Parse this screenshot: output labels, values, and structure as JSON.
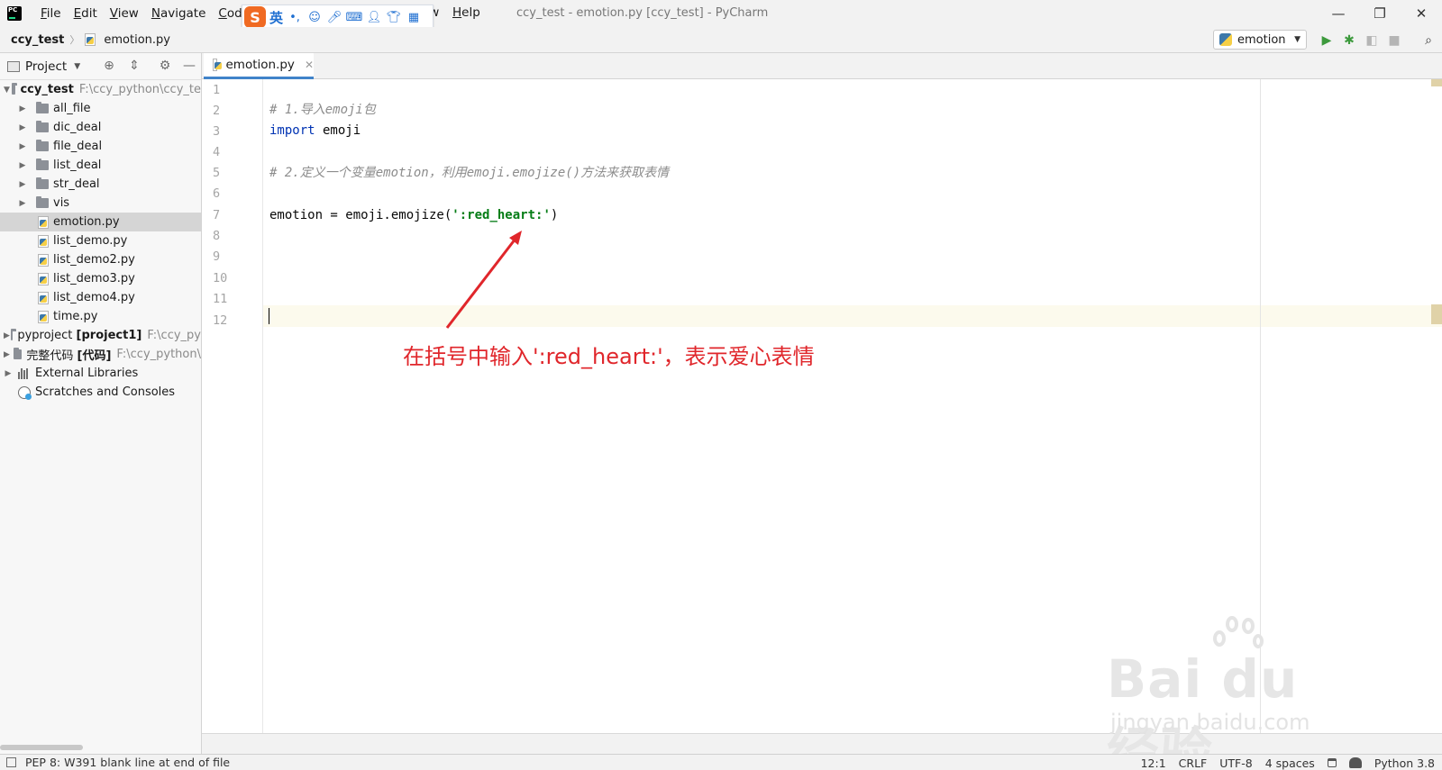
{
  "window": {
    "title": "ccy_test - emotion.py [ccy_test] - PyCharm",
    "controls": [
      "—",
      "❐",
      "✕"
    ]
  },
  "menu": {
    "items": [
      {
        "label": "File",
        "mnemonic": "F",
        "rest": "ile"
      },
      {
        "label": "Edit",
        "mnemonic": "E",
        "rest": "dit"
      },
      {
        "label": "View",
        "mnemonic": "V",
        "rest": "iew"
      },
      {
        "label": "Navigate",
        "mnemonic": "N",
        "rest": "avigate"
      },
      {
        "label": "Code",
        "mnemonic": "C",
        "rest": "ode"
      },
      {
        "label": "R",
        "mnemonic": "R",
        "rest": ""
      },
      {
        "label": "ow",
        "mnemonic": "",
        "rest": "ow"
      },
      {
        "label": "Help",
        "mnemonic": "H",
        "rest": "elp"
      }
    ]
  },
  "ime": {
    "logo": "S",
    "mode": "英",
    "punct": "•,"
  },
  "navbar": {
    "project": "ccy_test",
    "file": "emotion.py",
    "run_config": "emotion"
  },
  "project_panel": {
    "title": "Project",
    "tree": [
      {
        "label": "ccy_test",
        "hint": "F:\\ccy_python\\ccy_te",
        "type": "folder",
        "expanded": true,
        "depth": 0,
        "bold": true
      },
      {
        "label": "all_file",
        "type": "folder",
        "expanded": false,
        "depth": 1
      },
      {
        "label": "dic_deal",
        "type": "folder",
        "expanded": false,
        "depth": 1
      },
      {
        "label": "file_deal",
        "type": "folder",
        "expanded": false,
        "depth": 1
      },
      {
        "label": "list_deal",
        "type": "folder",
        "expanded": false,
        "depth": 1
      },
      {
        "label": "str_deal",
        "type": "folder",
        "expanded": false,
        "depth": 1
      },
      {
        "label": "vis",
        "type": "folder",
        "expanded": false,
        "depth": 1
      },
      {
        "label": "emotion.py",
        "type": "py",
        "depth": 1,
        "selected": true
      },
      {
        "label": "list_demo.py",
        "type": "py",
        "depth": 1
      },
      {
        "label": "list_demo2.py",
        "type": "py",
        "depth": 1
      },
      {
        "label": "list_demo3.py",
        "type": "py",
        "depth": 1
      },
      {
        "label": "list_demo4.py",
        "type": "py",
        "depth": 1
      },
      {
        "label": "time.py",
        "type": "py",
        "depth": 1
      },
      {
        "label": "pyproject",
        "bold_suffix": "[project1]",
        "hint": "F:\\ccy_py",
        "type": "folder",
        "expanded": false,
        "depth": 0
      },
      {
        "label": "完整代码",
        "bold_suffix": "[代码]",
        "hint": "F:\\ccy_python\\",
        "type": "folder",
        "expanded": false,
        "depth": 0
      },
      {
        "label": "External Libraries",
        "type": "libs",
        "expanded": false,
        "depth": 0
      },
      {
        "label": "Scratches and Consoles",
        "type": "scratch",
        "depth": 0
      }
    ]
  },
  "editor": {
    "tab_label": "emotion.py",
    "line_numbers": [
      "1",
      "2",
      "3",
      "4",
      "5",
      "6",
      "7",
      "8",
      "9",
      "10",
      "11",
      "12"
    ],
    "code": {
      "line2": "# 1.导入emoji包",
      "line3_kw": "import",
      "line3_rest": " emoji",
      "line5": "# 2.定义一个变量emotion，利用emoji.emojize()方法来获取表情",
      "line7_pre": "emotion = emoji.emojize(",
      "line7_str": "':red_heart:'",
      "line7_post": ")"
    },
    "annotation": "在括号中输入':red_heart:'，表示爱心表情",
    "annotation_color": "#e0262b"
  },
  "status": {
    "message": "PEP 8: W391 blank line at end of file",
    "position": "12:1",
    "line_sep": "CRLF",
    "encoding": "UTF-8",
    "indent": "4 spaces",
    "interpreter": "Python 3.8"
  },
  "watermark": {
    "brand": "Bai du 经验",
    "url": "jingyan.baidu.com"
  },
  "colors": {
    "keyword": "#0033b3",
    "comment": "#8c8c8c",
    "string": "#067d17",
    "tab_accent": "#4083c9",
    "run_green": "#3d9a3d"
  }
}
